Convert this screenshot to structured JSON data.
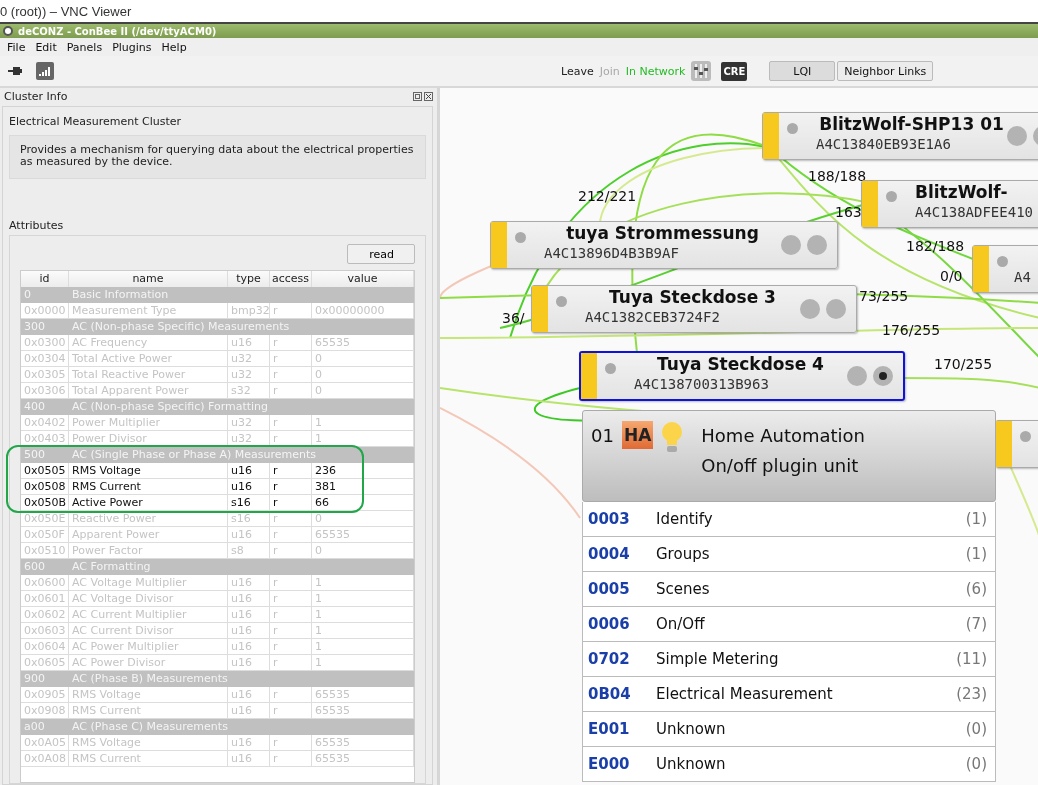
{
  "viewer_title": "0 (root)) – VNC Viewer",
  "window": {
    "title": "deCONZ - ConBee II (/dev/ttyACM0)"
  },
  "menu": [
    "File",
    "Edit",
    "Panels",
    "Plugins",
    "Help"
  ],
  "toolbar": [
    {
      "kind": "action",
      "label": "Leave",
      "disabled": false
    },
    {
      "kind": "action",
      "label": "Join",
      "disabled": true
    },
    {
      "kind": "status",
      "label": "In Network"
    },
    {
      "kind": "mixer"
    },
    {
      "kind": "badge",
      "label": "CRE"
    },
    {
      "kind": "button",
      "label": "LQI",
      "pressed": true
    },
    {
      "kind": "button",
      "label": "Neighbor Links",
      "pressed": false
    }
  ],
  "panel": {
    "title": "Cluster Info",
    "cluster_name": "Electrical Measurement Cluster",
    "description": "Provides a mechanism for querying data about the electrical properties as measured by the device.",
    "attributes_label": "Attributes",
    "read_button": "read",
    "columns": [
      "id",
      "name",
      "type",
      "access",
      "value"
    ],
    "rows": [
      {
        "kind": "group",
        "id": "0",
        "name": "Basic Information"
      },
      {
        "kind": "attribute",
        "id": "0x0000",
        "name": "Measurement Type",
        "type": "bmp32",
        "access": "r",
        "value": "0x00000000",
        "available": false
      },
      {
        "kind": "group",
        "id": "300",
        "name": "AC (Non-phase Specific) Measurements"
      },
      {
        "kind": "attribute",
        "id": "0x0300",
        "name": "AC Frequency",
        "type": "u16",
        "access": "r",
        "value": "65535",
        "available": false
      },
      {
        "kind": "attribute",
        "id": "0x0304",
        "name": "Total Active Power",
        "type": "u32",
        "access": "r",
        "value": "0",
        "available": false
      },
      {
        "kind": "attribute",
        "id": "0x0305",
        "name": "Total Reactive Power",
        "type": "u32",
        "access": "r",
        "value": "0",
        "available": false
      },
      {
        "kind": "attribute",
        "id": "0x0306",
        "name": "Total Apparent Power",
        "type": "s32",
        "access": "r",
        "value": "0",
        "available": false
      },
      {
        "kind": "group",
        "id": "400",
        "name": "AC (Non-phase Specific) Formatting"
      },
      {
        "kind": "attribute",
        "id": "0x0402",
        "name": "Power Multiplier",
        "type": "u32",
        "access": "r",
        "value": "1",
        "available": false
      },
      {
        "kind": "attribute",
        "id": "0x0403",
        "name": "Power Divisor",
        "type": "u32",
        "access": "r",
        "value": "1",
        "available": false
      },
      {
        "kind": "group",
        "id": "500",
        "name": "AC (Single Phase or Phase A) Measurements"
      },
      {
        "kind": "attribute",
        "id": "0x0505",
        "name": "RMS Voltage",
        "type": "u16",
        "access": "r",
        "value": "236",
        "available": true
      },
      {
        "kind": "attribute",
        "id": "0x0508",
        "name": "RMS Current",
        "type": "u16",
        "access": "r",
        "value": "381",
        "available": true
      },
      {
        "kind": "attribute",
        "id": "0x050B",
        "name": "Active Power",
        "type": "s16",
        "access": "r",
        "value": "66",
        "available": true
      },
      {
        "kind": "attribute",
        "id": "0x050E",
        "name": "Reactive Power",
        "type": "s16",
        "access": "r",
        "value": "0",
        "available": false
      },
      {
        "kind": "attribute",
        "id": "0x050F",
        "name": "Apparent Power",
        "type": "u16",
        "access": "r",
        "value": "65535",
        "available": false
      },
      {
        "kind": "attribute",
        "id": "0x0510",
        "name": "Power Factor",
        "type": "s8",
        "access": "r",
        "value": "0",
        "available": false
      },
      {
        "kind": "group",
        "id": "600",
        "name": "AC Formatting"
      },
      {
        "kind": "attribute",
        "id": "0x0600",
        "name": "AC Voltage Multiplier",
        "type": "u16",
        "access": "r",
        "value": "1",
        "available": false
      },
      {
        "kind": "attribute",
        "id": "0x0601",
        "name": "AC Voltage Divisor",
        "type": "u16",
        "access": "r",
        "value": "1",
        "available": false
      },
      {
        "kind": "attribute",
        "id": "0x0602",
        "name": "AC Current Multiplier",
        "type": "u16",
        "access": "r",
        "value": "1",
        "available": false
      },
      {
        "kind": "attribute",
        "id": "0x0603",
        "name": "AC Current Divisor",
        "type": "u16",
        "access": "r",
        "value": "1",
        "available": false
      },
      {
        "kind": "attribute",
        "id": "0x0604",
        "name": "AC Power Multiplier",
        "type": "u16",
        "access": "r",
        "value": "1",
        "available": false
      },
      {
        "kind": "attribute",
        "id": "0x0605",
        "name": "AC Power Divisor",
        "type": "u16",
        "access": "r",
        "value": "1",
        "available": false
      },
      {
        "kind": "group",
        "id": "900",
        "name": "AC (Phase B) Measurements"
      },
      {
        "kind": "attribute",
        "id": "0x0905",
        "name": "RMS Voltage",
        "type": "u16",
        "access": "r",
        "value": "65535",
        "available": false
      },
      {
        "kind": "attribute",
        "id": "0x0908",
        "name": "RMS Current",
        "type": "u16",
        "access": "r",
        "value": "65535",
        "available": false
      },
      {
        "kind": "group",
        "id": "a00",
        "name": "AC (Phase C) Measurements"
      },
      {
        "kind": "attribute",
        "id": "0x0A05",
        "name": "RMS Voltage",
        "type": "u16",
        "access": "r",
        "value": "65535",
        "available": false
      },
      {
        "kind": "attribute",
        "id": "0x0A08",
        "name": "RMS Current",
        "type": "u16",
        "access": "r",
        "value": "65535",
        "available": false
      }
    ]
  },
  "graph": {
    "nodes": [
      {
        "name": "BlitzWolf-SHP13 01",
        "address": "A4C13840EB93E1A6",
        "selected": false
      },
      {
        "name": "BlitzWolf-",
        "address": "A4C138ADFEE410",
        "selected": false
      },
      {
        "name": "tuya Strommessung",
        "address": "A4C13896D4B3B9AF",
        "selected": false
      },
      {
        "address": "A4",
        "selected": false
      },
      {
        "name": "Tuya Steckdose 3",
        "address": "A4C1382CEB3724F2",
        "selected": false
      },
      {
        "name": "Tuya Steckdose 4",
        "address": "A4C138700313B963",
        "selected": true
      },
      {
        "selected": false
      }
    ],
    "link_labels": [
      "212/221",
      "188/188",
      "163",
      "182/188",
      "0/0",
      "73/255",
      "36/",
      "176/255",
      "170/255"
    ],
    "endpoint": {
      "number": "01",
      "profile_badge": "HA",
      "profile": "Home Automation",
      "device_type": "On/off plugin unit",
      "clusters": [
        {
          "id": "0003",
          "name": "Identify",
          "count": "(1)"
        },
        {
          "id": "0004",
          "name": "Groups",
          "count": "(1)"
        },
        {
          "id": "0005",
          "name": "Scenes",
          "count": "(6)"
        },
        {
          "id": "0006",
          "name": "On/Off",
          "count": "(7)"
        },
        {
          "id": "0702",
          "name": "Simple Metering",
          "count": "(11)"
        },
        {
          "id": "0B04",
          "name": "Electrical Measurement",
          "count": "(23)"
        },
        {
          "id": "E001",
          "name": "Unknown",
          "count": "(0)"
        },
        {
          "id": "E000",
          "name": "Unknown",
          "count": "(0)"
        }
      ]
    }
  }
}
